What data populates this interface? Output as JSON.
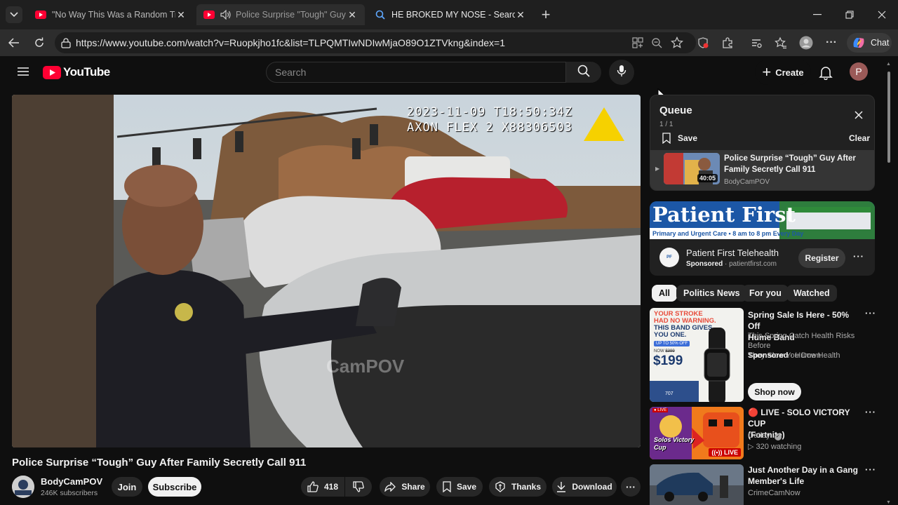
{
  "browser": {
    "tabs": [
      {
        "title": "\"No Way This Was a Random Traffic",
        "active": false
      },
      {
        "title": "Police Surprise \"Tough\" Guy After",
        "active": true
      },
      {
        "title": "HE BROKED MY NOSE - Search",
        "active": false
      }
    ],
    "url": "https://www.youtube.com/watch?v=Ruopkjho1fc&list=TLPQMTIwNDIwMjaO89O1ZTVkng&index=1",
    "copilot_label": "Chat"
  },
  "youtube": {
    "logo_text": "YouTube",
    "search_placeholder": "Search",
    "create_label": "Create",
    "avatar_letter": "P"
  },
  "video": {
    "timestamp_line1": "2023-11-09 T18:50:34Z",
    "timestamp_line2": "AXON FLEX 2 X88306503",
    "watermark": "CamPOV",
    "title": "Police Surprise “Tough” Guy After Family Secretly Call 911",
    "channel": "BodyCamPOV",
    "subscribers": "246K subscribers",
    "join_label": "Join",
    "subscribe_label": "Subscribe",
    "likes": "418",
    "share_label": "Share",
    "save_label": "Save",
    "thanks_label": "Thanks",
    "download_label": "Download"
  },
  "queue": {
    "title": "Queue",
    "position": "1 / 1",
    "save_label": "Save",
    "clear_label": "Clear",
    "item": {
      "title": "Police Surprise “Tough” Guy After Family Secretly Call 911",
      "channel": "BodyCamPOV",
      "duration": "40:05"
    }
  },
  "ad": {
    "banner_text": "Patient First",
    "banner_sub": "Primary and Urgent Care • 8 am to 8 pm Every Day",
    "title": "Patient First Telehealth",
    "sponsored": "Sponsored",
    "domain": "patientfirst.com",
    "register_label": "Register"
  },
  "chips": [
    "All",
    "Politics News",
    "For you",
    "Watched"
  ],
  "recommendations": [
    {
      "title_line1": "Spring Sale Is Here - 50% Off",
      "title_line2": "Hume Band",
      "desc_line1": "This Spring Catch Health Risks Before",
      "desc_line2": "They Slow You Down",
      "sponsored": "Sponsored",
      "advertiser": "Hume Health",
      "cta": "Shop now",
      "thumb_line1": "YOUR STROKE",
      "thumb_line2": "HAD NO WARNING.",
      "thumb_line3": "THIS BAND GIVES",
      "thumb_line4": "YOU ONE.",
      "thumb_badge": "UP TO 50% OFF",
      "thumb_now": "NOW",
      "thumb_was": "$399",
      "thumb_price": "$199",
      "thumb_stat": "707"
    },
    {
      "title_line1": "🔴 LIVE - SOLO VICTORY CUP",
      "title_line2": "(Fortnite)",
      "channel": "Oatley",
      "meta": "▷ 320 watching",
      "live_badge": "LIVE",
      "thumb_text": "Solos Victory Cup"
    },
    {
      "title_line1": "Just Another Day in a Gang",
      "title_line2": "Member's Life",
      "channel": "CrimeCamNow"
    }
  ]
}
